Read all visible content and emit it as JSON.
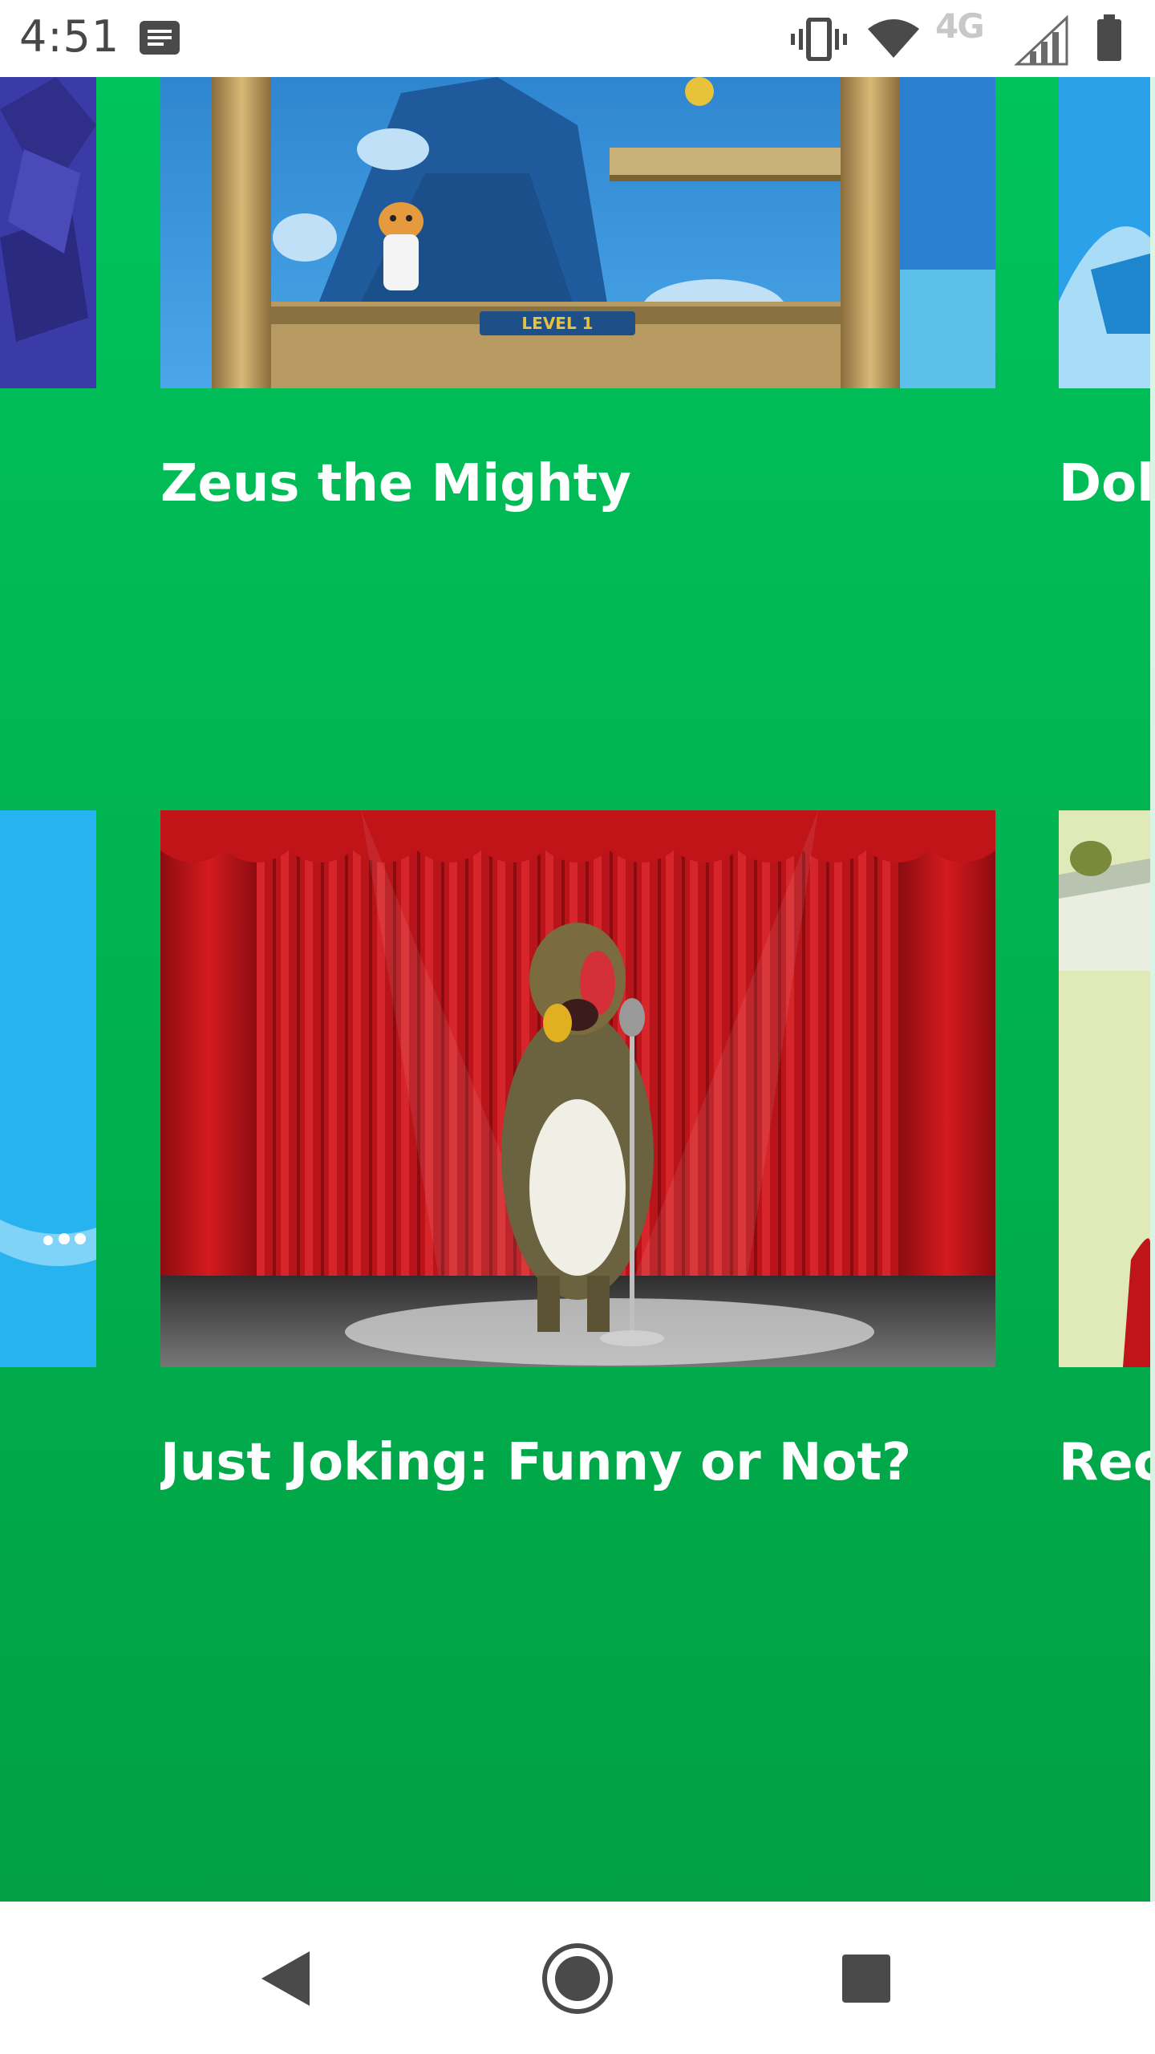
{
  "status_bar": {
    "time": "4:51",
    "network": "4G",
    "notification_icon": "message-icon",
    "icons": [
      "vibrate-icon",
      "wifi-icon",
      "signal-icon",
      "battery-icon"
    ]
  },
  "theme": {
    "background_top": "#00c35b",
    "background_bottom": "#00a043"
  },
  "cards": [
    {
      "title": "Zeus the Mighty",
      "image": "zeus-game-thumbnail"
    },
    {
      "title": "Dolp",
      "image": "dolphin-game-thumbnail"
    },
    {
      "title": "Just Joking: Funny or Not?",
      "image": "baboon-on-stage-thumbnail"
    },
    {
      "title": "Recy",
      "image": "recycle-game-thumbnail"
    }
  ],
  "nav_bar": {
    "buttons": [
      "back",
      "home",
      "recents"
    ]
  }
}
